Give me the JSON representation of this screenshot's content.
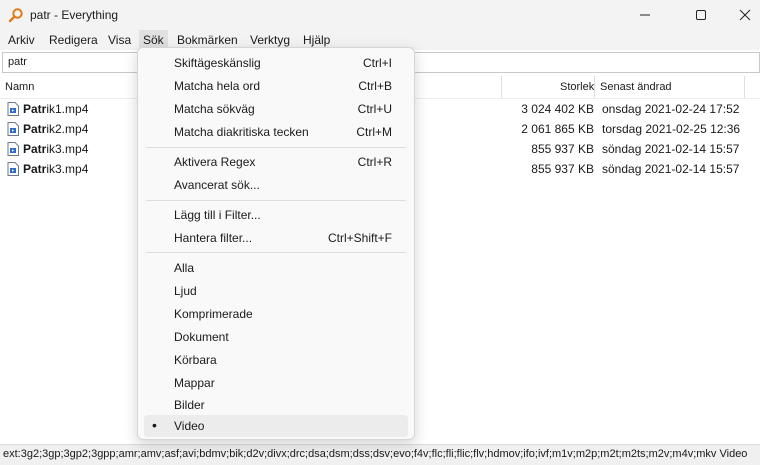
{
  "window": {
    "title": "patr - Everything",
    "icon": "magnifier-icon"
  },
  "menubar": {
    "items": [
      "Arkiv",
      "Redigera",
      "Visa",
      "Sök",
      "Bokmärken",
      "Verktyg",
      "Hjälp"
    ],
    "active": "Sök"
  },
  "search": {
    "value": "patr"
  },
  "columns": {
    "name": "Namn",
    "size": "Storlek",
    "modified": "Senast ändrad"
  },
  "files": [
    {
      "match": "Patr",
      "rest": "ik1.mp4",
      "size": "3 024 402 KB",
      "date": "onsdag 2021-02-24 17:52"
    },
    {
      "match": "Patr",
      "rest": "ik2.mp4",
      "size": "2 061 865 KB",
      "date": "torsdag 2021-02-25 12:36"
    },
    {
      "match": "Patr",
      "rest": "ik3.mp4",
      "size": "855 937 KB",
      "date": "söndag 2021-02-14 15:57"
    },
    {
      "match": "Patr",
      "rest": "ik3.mp4",
      "size": "855 937 KB",
      "date": "söndag 2021-02-14 15:57"
    }
  ],
  "dropdown": {
    "items": [
      {
        "label": "Skiftägeskänslig",
        "shortcut": "Ctrl+I"
      },
      {
        "label": "Matcha hela ord",
        "shortcut": "Ctrl+B"
      },
      {
        "label": "Matcha sökväg",
        "shortcut": "Ctrl+U"
      },
      {
        "label": "Matcha diakritiska tecken",
        "shortcut": "Ctrl+M"
      },
      {
        "label": "Aktivera Regex",
        "shortcut": "Ctrl+R"
      },
      {
        "label": "Avancerat sök...",
        "shortcut": ""
      },
      {
        "label": "Lägg till i Filter...",
        "shortcut": ""
      },
      {
        "label": "Hantera filter...",
        "shortcut": "Ctrl+Shift+F"
      },
      {
        "label": "Alla",
        "shortcut": ""
      },
      {
        "label": "Ljud",
        "shortcut": ""
      },
      {
        "label": "Komprimerade",
        "shortcut": ""
      },
      {
        "label": "Dokument",
        "shortcut": ""
      },
      {
        "label": "Körbara",
        "shortcut": ""
      },
      {
        "label": "Mappar",
        "shortcut": ""
      },
      {
        "label": "Bilder",
        "shortcut": ""
      },
      {
        "label": "Video",
        "shortcut": ""
      }
    ],
    "selected_bullet": "•"
  },
  "statusbar": {
    "text": "ext:3g2;3gp;3gp2;3gpp;amr;amv;asf;avi;bdmv;bik;d2v;divx;drc;dsa;dsm;dss;dsv;evo;f4v;flc;fli;flic;flv;hdmov;ifo;ivf;m1v;m2p;m2t;m2ts;m2v;m4v;mkv Video"
  },
  "colors": {
    "accent": "#1a63b8",
    "hover": "#ececec",
    "menubar_bg": "#f3f3f3"
  }
}
